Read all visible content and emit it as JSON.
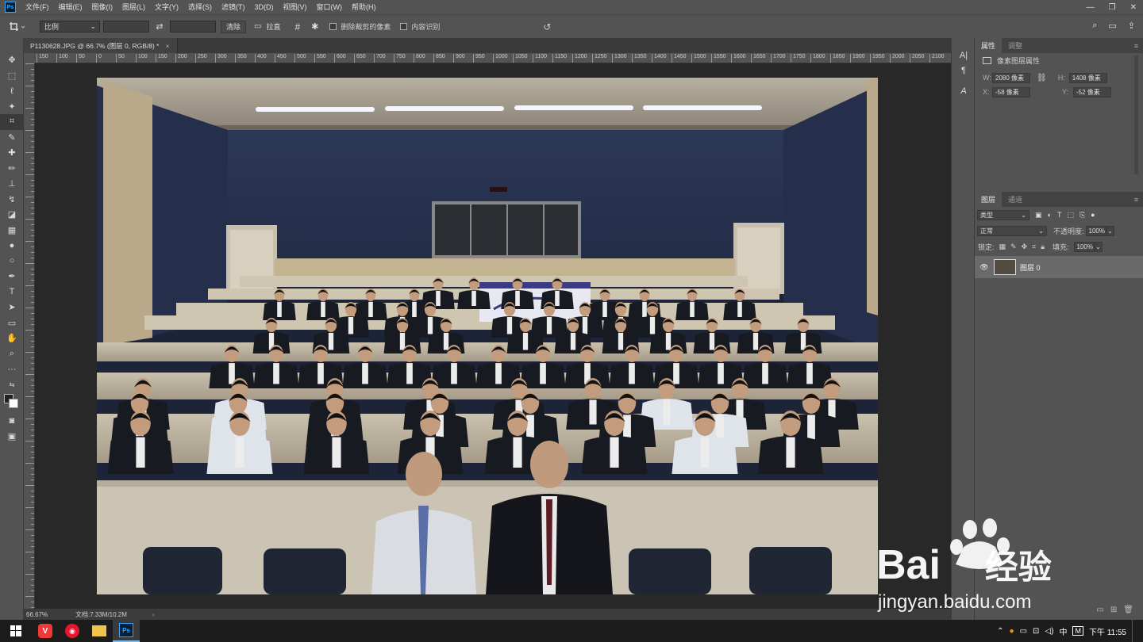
{
  "menubar": {
    "logo": "Ps",
    "items": [
      "文件(F)",
      "编辑(E)",
      "图像(I)",
      "图层(L)",
      "文字(Y)",
      "选择(S)",
      "滤镜(T)",
      "3D(D)",
      "视图(V)",
      "窗口(W)",
      "帮助(H)"
    ],
    "controls": [
      "—",
      "❐",
      "✕"
    ]
  },
  "options": {
    "ratio_select": "比例",
    "clear_label": "清除",
    "straighten_label": "拉直",
    "delete_cropped_label": "删除裁剪的像素",
    "content_aware_label": "内容识别"
  },
  "document": {
    "tab_title": "P1130628.JPG @ 66.7% (图层 0, RGB/8) *",
    "tab_close": "×",
    "zoom": "66.67%",
    "doc_info": "文档:7.33M/10.2M",
    "ruler_labels": [
      "150",
      "100",
      "50",
      "0",
      "50",
      "100",
      "150",
      "200",
      "250",
      "300",
      "350",
      "400",
      "450",
      "500",
      "550",
      "600",
      "650",
      "700",
      "750",
      "800",
      "850",
      "900",
      "950",
      "1000",
      "1050",
      "1100",
      "1150",
      "1200",
      "1250",
      "1300",
      "1350",
      "1400",
      "1450",
      "1500",
      "1550",
      "1600",
      "1650",
      "1700",
      "1750",
      "1800",
      "1850",
      "1900",
      "1950",
      "2000",
      "2050",
      "2100"
    ]
  },
  "properties": {
    "tabs": [
      "属性",
      "调整"
    ],
    "header": "像素图层属性",
    "w_label": "W:",
    "w_value": "2080 像素",
    "h_label": "H:",
    "h_value": "1408 像素",
    "x_label": "X:",
    "x_value": "-58 像素",
    "y_label": "Y:",
    "y_value": "-52 像素"
  },
  "layers": {
    "tabs": [
      "图层",
      "通道"
    ],
    "filter": "类型",
    "blend_mode": "正常",
    "opacity_label": "不透明度:",
    "opacity_value": "100%",
    "lock_label": "锁定:",
    "fill_label": "填充:",
    "fill_value": "100%",
    "layer_name": "图层 0"
  },
  "taskbar": {
    "lang": "中",
    "time": "下午 11:55"
  },
  "watermark": {
    "brand": "Bai",
    "brand_cn": "经验",
    "url": "jingyan.baidu.com"
  }
}
